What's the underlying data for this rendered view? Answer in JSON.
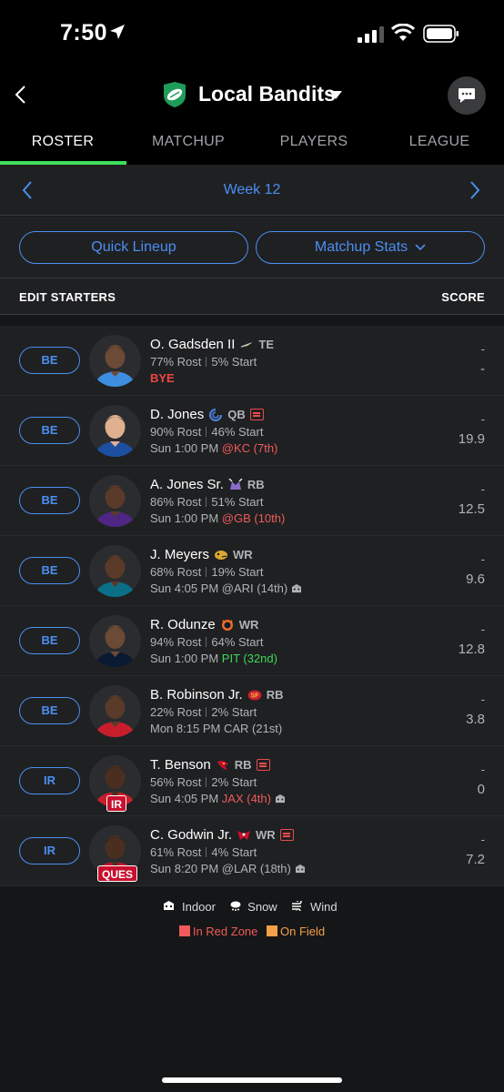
{
  "status": {
    "time": "7:50"
  },
  "header": {
    "team_name": "Local Bandits"
  },
  "tabs": [
    {
      "label": "ROSTER",
      "active": true
    },
    {
      "label": "MATCHUP",
      "active": false
    },
    {
      "label": "PLAYERS",
      "active": false
    },
    {
      "label": "LEAGUE",
      "active": false
    }
  ],
  "week": {
    "label": "Week 12"
  },
  "actions": {
    "quick_lineup": "Quick Lineup",
    "matchup_stats": "Matchup Stats"
  },
  "list_header": {
    "left": "EDIT STARTERS",
    "right": "SCORE"
  },
  "players": [
    {
      "slot": "BE",
      "name": "O. Gadsden II",
      "team_icon": "chargers-logo",
      "pos": "TE",
      "news": false,
      "rost": "77% Rost",
      "start": "5% Start",
      "game_time": "",
      "opp": "BYE",
      "opp_class": "bye",
      "weather": "",
      "badge": "",
      "proj": "-",
      "score": "-"
    },
    {
      "slot": "BE",
      "name": "D. Jones",
      "team_icon": "colts-logo",
      "pos": "QB",
      "news": true,
      "rost": "90% Rost",
      "start": "46% Start",
      "game_time": "Sun 1:00 PM",
      "opp": "@KC (7th)",
      "opp_class": "bad",
      "weather": "",
      "badge": "",
      "proj": "-",
      "score": "19.9"
    },
    {
      "slot": "BE",
      "name": "A. Jones Sr.",
      "team_icon": "vikings-logo",
      "pos": "RB",
      "news": false,
      "rost": "86% Rost",
      "start": "51% Start",
      "game_time": "Sun 1:00 PM",
      "opp": "@GB (10th)",
      "opp_class": "bad",
      "weather": "",
      "badge": "",
      "proj": "-",
      "score": "12.5"
    },
    {
      "slot": "BE",
      "name": "J. Meyers",
      "team_icon": "jaguars-logo",
      "pos": "WR",
      "news": false,
      "rost": "68% Rost",
      "start": "19% Start",
      "game_time": "Sun 4:05 PM",
      "opp": "@ARI (14th)",
      "opp_class": "neutral",
      "weather": "indoor",
      "badge": "",
      "proj": "-",
      "score": "9.6"
    },
    {
      "slot": "BE",
      "name": "R. Odunze",
      "team_icon": "bears-logo",
      "pos": "WR",
      "news": false,
      "rost": "94% Rost",
      "start": "64% Start",
      "game_time": "Sun 1:00 PM",
      "opp": "PIT (32nd)",
      "opp_class": "good",
      "weather": "",
      "badge": "",
      "proj": "-",
      "score": "12.8"
    },
    {
      "slot": "BE",
      "name": "B. Robinson Jr.",
      "team_icon": "49ers-logo",
      "pos": "RB",
      "news": false,
      "rost": "22% Rost",
      "start": "2% Start",
      "game_time": "Mon 8:15 PM",
      "opp": "CAR (21st)",
      "opp_class": "neutral",
      "weather": "",
      "badge": "",
      "proj": "-",
      "score": "3.8"
    },
    {
      "slot": "IR",
      "name": "T. Benson",
      "team_icon": "cardinals-logo",
      "pos": "RB",
      "news": true,
      "rost": "56% Rost",
      "start": "2% Start",
      "game_time": "Sun 4:05 PM",
      "opp": "JAX (4th)",
      "opp_class": "bad",
      "weather": "indoor",
      "badge": "IR",
      "proj": "-",
      "score": "0"
    },
    {
      "slot": "IR",
      "name": "C. Godwin Jr.",
      "team_icon": "buccaneers-logo",
      "pos": "WR",
      "news": true,
      "rost": "61% Rost",
      "start": "4% Start",
      "game_time": "Sun 8:20 PM",
      "opp": "@LAR (18th)",
      "opp_class": "neutral",
      "weather": "indoor",
      "badge": "QUES",
      "proj": "-",
      "score": "7.2"
    }
  ],
  "legend": {
    "indoor": "Indoor",
    "snow": "Snow",
    "wind": "Wind",
    "red_zone": "In Red Zone",
    "on_field": "On Field",
    "red_zone_color": "#ef5b5b",
    "on_field_color": "#f5a04a"
  },
  "colors": {
    "accent_blue": "#4b8ff2",
    "active_tab": "#3fe05a"
  }
}
